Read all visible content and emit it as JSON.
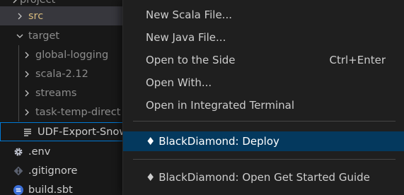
{
  "explorer": {
    "items": [
      {
        "label": "project",
        "kind": "folder",
        "expanded": false,
        "ignored": true
      },
      {
        "label": "src",
        "kind": "folder",
        "expanded": false,
        "ignored": false
      },
      {
        "label": "target",
        "kind": "folder",
        "expanded": true,
        "ignored": true
      },
      {
        "label": "global-logging",
        "kind": "folder",
        "expanded": false,
        "ignored": true
      },
      {
        "label": "scala-2.12",
        "kind": "folder",
        "expanded": false,
        "ignored": true
      },
      {
        "label": "streams",
        "kind": "folder",
        "expanded": false,
        "ignored": true
      },
      {
        "label": "task-temp-direct",
        "kind": "folder",
        "expanded": false,
        "ignored": true
      },
      {
        "label": "UDF-Export-Snow",
        "kind": "file",
        "icon": "list-file-icon",
        "ignored": false
      },
      {
        "label": ".env",
        "kind": "file",
        "icon": "gear-icon",
        "ignored": false
      },
      {
        "label": ".gitignore",
        "kind": "file",
        "icon": "git-icon",
        "ignored": false
      },
      {
        "label": "build.sbt",
        "kind": "file",
        "icon": "sbt-icon",
        "ignored": false
      }
    ]
  },
  "context_menu": {
    "items": [
      {
        "label": "New Scala File..."
      },
      {
        "label": "New Java File..."
      },
      {
        "label": "Open to the Side",
        "shortcut": "Ctrl+Enter"
      },
      {
        "label": "Open With..."
      },
      {
        "label": "Open in Integrated Terminal"
      },
      {
        "label": "♦ BlackDiamond: Deploy",
        "highlighted": true
      },
      {
        "label": "♦ BlackDiamond: Open Get Started Guide"
      }
    ]
  },
  "colors": {
    "sidebar_bg": "#181818",
    "menu_bg": "#1f1f1f",
    "menu_highlight": "#04395e",
    "selection_bg": "#37373d",
    "focus_border": "#0078d4",
    "src_folder_text": "#d7ba7d",
    "ignored_text": "#8c8c8c",
    "text": "#cccccc"
  }
}
